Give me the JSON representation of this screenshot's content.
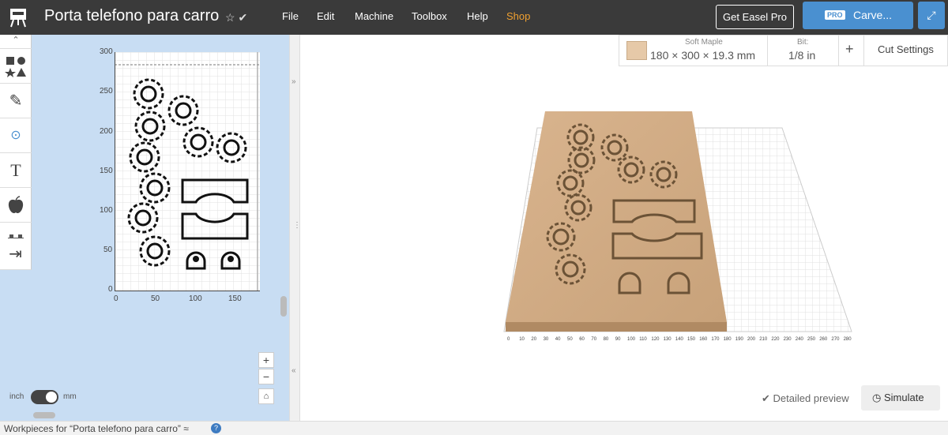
{
  "app": {
    "title": "Porta telefono para carro",
    "title_icons": "☆ ✔"
  },
  "menu": [
    {
      "label": "File"
    },
    {
      "label": "Edit"
    },
    {
      "label": "Machine"
    },
    {
      "label": "Toolbox"
    },
    {
      "label": "Help"
    },
    {
      "label": "Shop"
    }
  ],
  "header_buttons": {
    "get_pro": "Get Easel Pro",
    "carve_badge": "PRO",
    "carve": "Carve..."
  },
  "tools": [
    {
      "icon": "shapes-icon",
      "glyph": "■●\n★▲"
    },
    {
      "icon": "pen-icon",
      "glyph": "✎"
    },
    {
      "icon": "point-icon",
      "glyph": "⊙"
    },
    {
      "icon": "text-icon",
      "glyph": "T"
    },
    {
      "icon": "apple-icon",
      "glyph": "🍎"
    },
    {
      "icon": "lego-icon",
      "glyph": "▦"
    },
    {
      "icon": "import-icon",
      "glyph": "⇥"
    }
  ],
  "design_axes": {
    "y_ticks": [
      "300",
      "250",
      "200",
      "150",
      "100",
      "50",
      "0"
    ],
    "x_ticks": [
      "0",
      "50",
      "100",
      "150"
    ]
  },
  "units": {
    "left": "inch",
    "right": "mm"
  },
  "material": {
    "name": "Soft Maple",
    "dims": "180 × 300 × 19.3 mm",
    "swatch_color": "#e6c9a8"
  },
  "bit": {
    "label": "Bit:",
    "value": "1/8 in"
  },
  "cut_settings": "Cut Settings",
  "preview": {
    "detailed": "Detailed preview",
    "simulate": "Simulate"
  },
  "preview_axis": {
    "ticks": [
      "0",
      "10",
      "20",
      "30",
      "40",
      "50",
      "60",
      "70",
      "80",
      "90",
      "100",
      "110",
      "120",
      "130",
      "140",
      "150",
      "160",
      "170",
      "180",
      "190",
      "200",
      "210",
      "220",
      "230",
      "240",
      "250",
      "260",
      "270",
      "280"
    ]
  },
  "bottom": {
    "workpieces": "Workpieces for “Porta telefono para carro” ≈"
  }
}
